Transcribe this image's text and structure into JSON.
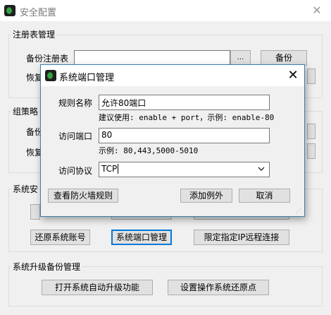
{
  "window": {
    "title": "安全配置",
    "close_glyph": "✕"
  },
  "registry": {
    "title": "注册表管理",
    "backup_label": "备份注册表",
    "browse_label": "...",
    "backup_button": "备份",
    "restore_label_partial": "恢复"
  },
  "policy": {
    "title_partial": "组策略",
    "backup_label_partial": "备份",
    "restore_label_partial": "恢复"
  },
  "security": {
    "title_partial": "系统安",
    "buttons": [
      "还原系统账号",
      "系统端口管理",
      "限定指定IP远程连接"
    ]
  },
  "upgrade": {
    "title": "系统升级备份管理",
    "buttons": [
      "打开系统自动升级功能",
      "设置操作系统还原点"
    ]
  },
  "dialog": {
    "title": "系统端口管理",
    "close_glyph": "✕",
    "rule_label": "规则名称",
    "rule_value": "允许80端口",
    "rule_hint": "建议使用: enable + port，示例: enable-80",
    "port_label": "访问端口",
    "port_value": "80",
    "port_hint": "示例: 80,443,5000-5010",
    "protocol_label": "访问协议",
    "protocol_value": "TCP",
    "view_button": "查看防火墙规则",
    "add_button": "添加例外",
    "cancel_button": "取消"
  }
}
